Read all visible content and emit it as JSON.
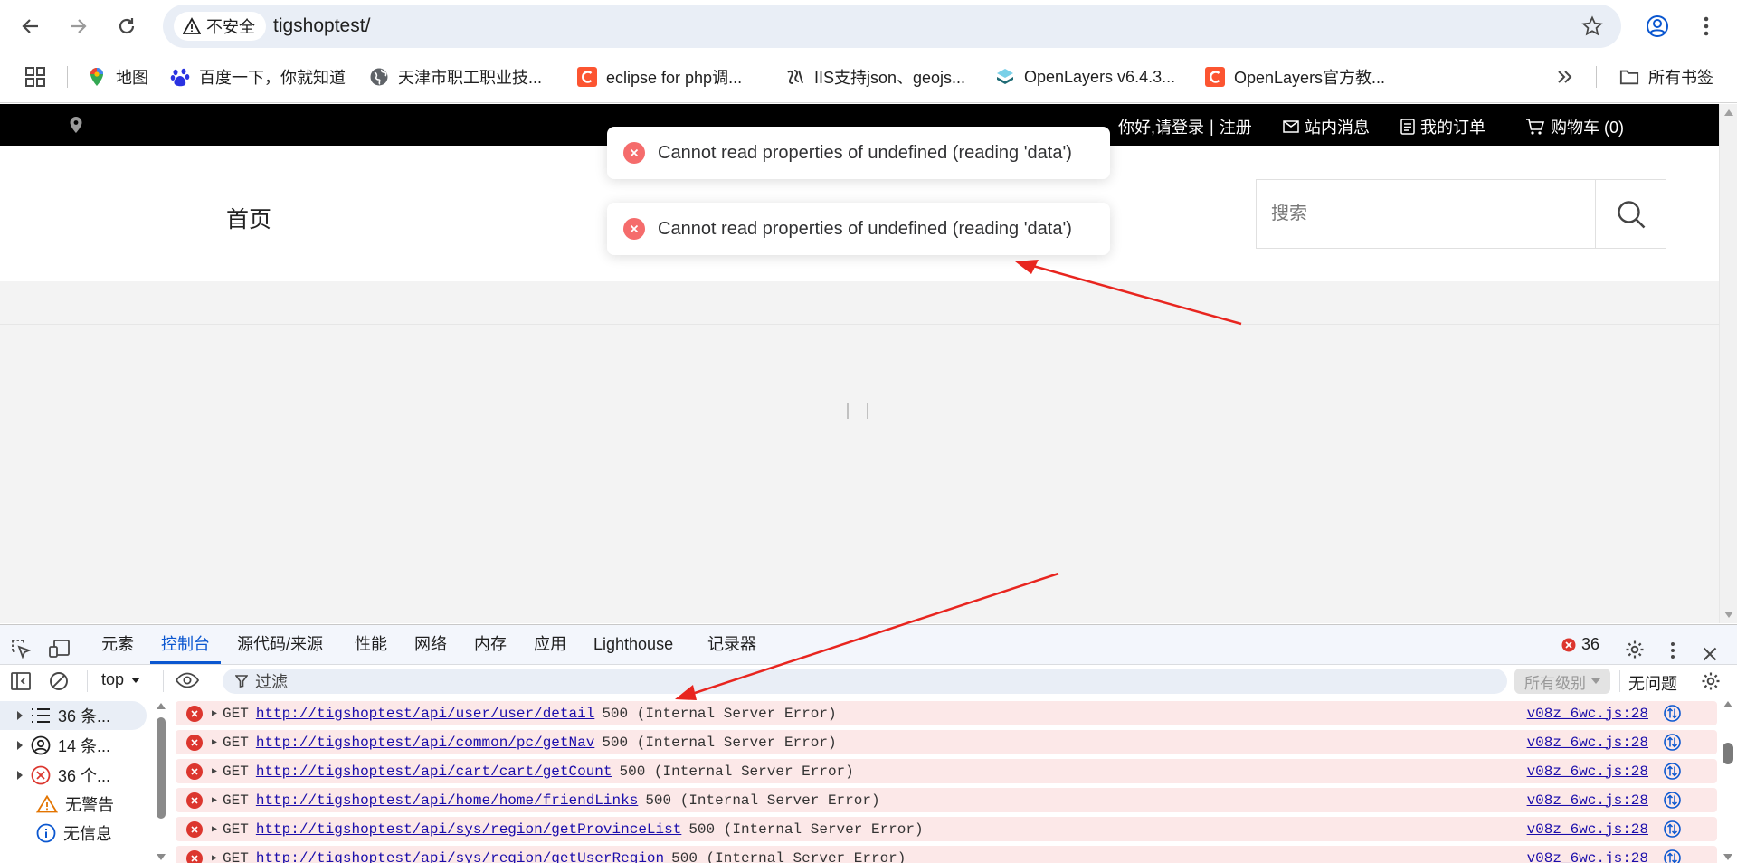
{
  "browser": {
    "security_label": "不安全",
    "url": "tigshoptest/",
    "bookmarks": [
      {
        "label": "地图"
      },
      {
        "label": "百度一下，你就知道"
      },
      {
        "label": "天津市职工职业技..."
      },
      {
        "label": "eclipse for php调..."
      },
      {
        "label": "IIS支持json、geojs..."
      },
      {
        "label": "OpenLayers v6.4.3..."
      },
      {
        "label": "OpenLayers官方教..."
      }
    ],
    "all_bookmarks": "所有书签"
  },
  "page": {
    "topbar": {
      "login": "你好,请登录",
      "divider": "|",
      "register": "注册",
      "messages": "站内消息",
      "orders": "我的订单",
      "cart": "购物车 (0)"
    },
    "nav_home": "首页",
    "search_placeholder": "搜索",
    "toasts": [
      {
        "message": "Cannot read properties of undefined (reading 'data')"
      },
      {
        "message": "Cannot read properties of undefined (reading 'data')"
      }
    ]
  },
  "devtools": {
    "tabs": [
      {
        "label": "元素"
      },
      {
        "label": "控制台"
      },
      {
        "label": "源代码/来源"
      },
      {
        "label": "性能"
      },
      {
        "label": "网络"
      },
      {
        "label": "内存"
      },
      {
        "label": "应用"
      },
      {
        "label": "Lighthouse"
      },
      {
        "label": "记录器"
      }
    ],
    "error_count": "36",
    "context": "top",
    "filter_placeholder": "过滤",
    "levels": "所有级别",
    "issues": "无问题",
    "sidebar": [
      {
        "label": "36 条..."
      },
      {
        "label": "14 条..."
      },
      {
        "label": "36 个..."
      },
      {
        "label": "无警告"
      },
      {
        "label": "无信息"
      }
    ],
    "logs": [
      {
        "method": "GET",
        "url": "http://tigshoptest/api/user/user/detail",
        "status": "500 (Internal Server Error)",
        "source": "v08z_6wc.js:28"
      },
      {
        "method": "GET",
        "url": "http://tigshoptest/api/common/pc/getNav",
        "status": "500 (Internal Server Error)",
        "source": "v08z_6wc.js:28"
      },
      {
        "method": "GET",
        "url": "http://tigshoptest/api/cart/cart/getCount",
        "status": "500 (Internal Server Error)",
        "source": "v08z_6wc.js:28"
      },
      {
        "method": "GET",
        "url": "http://tigshoptest/api/home/home/friendLinks",
        "status": "500 (Internal Server Error)",
        "source": "v08z_6wc.js:28"
      },
      {
        "method": "GET",
        "url": "http://tigshoptest/api/sys/region/getProvinceList",
        "status": "500 (Internal Server Error)",
        "source": "v08z_6wc.js:28"
      },
      {
        "method": "GET",
        "url": "http://tigshoptest/api/sys/region/getUserRegion",
        "status": "500 (Internal Server Error)",
        "source": "v08z_6wc.js:28"
      }
    ]
  },
  "colors": {
    "accent": "#0b57d0",
    "error": "#dc362e",
    "toast_error": "#f56c6c",
    "log_row_bg": "#fce8e8",
    "annotation_arrow": "#e8251f"
  }
}
